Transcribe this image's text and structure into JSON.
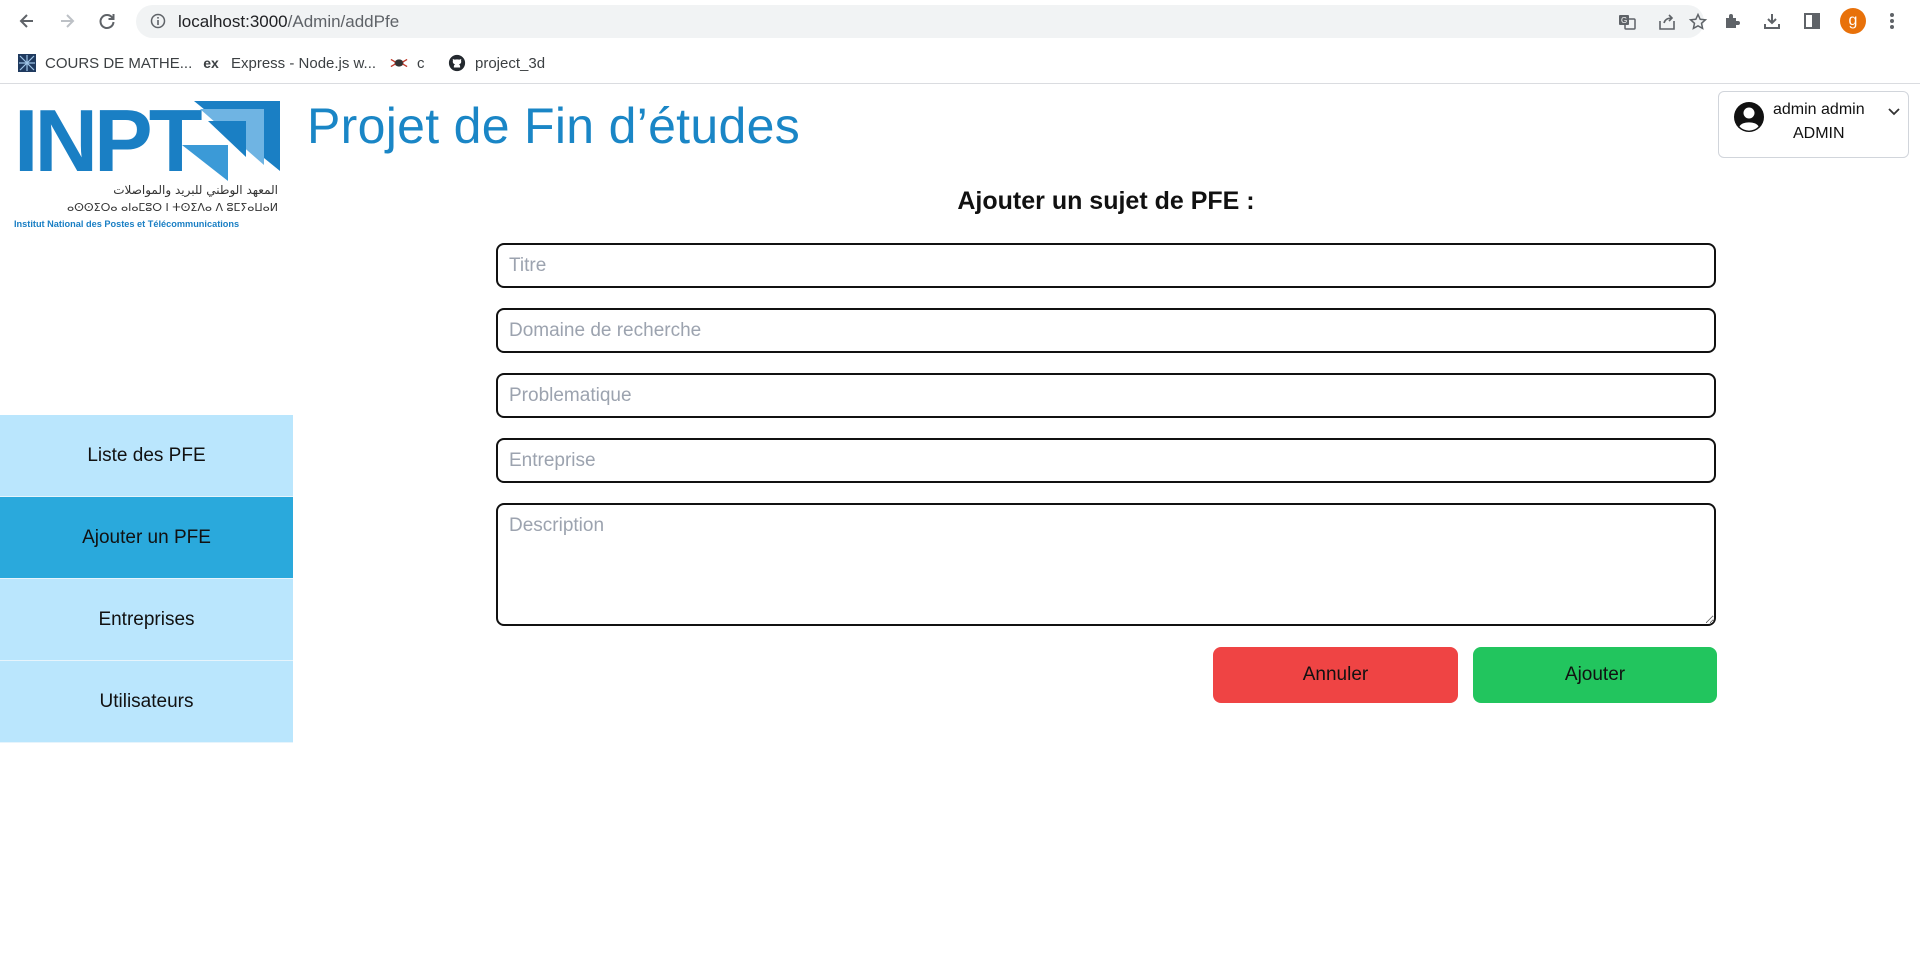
{
  "browser": {
    "url_host": "localhost:3000",
    "url_path": "/Admin/addPfe",
    "profile_initial": "g",
    "bookmarks": [
      {
        "label": "COURS DE MATHE...",
        "icon": "grid-favicon"
      },
      {
        "label": "Express - Node.js w...",
        "icon": "ex"
      },
      {
        "label": "c",
        "icon": "bug-favicon"
      },
      {
        "label": "project_3d",
        "icon": "github-icon"
      }
    ]
  },
  "header": {
    "site_title": "Projet de Fin d’études",
    "logo": {
      "main_text": "INPT",
      "arabic_text": "المعهد الوطني للبريد والمواصلات",
      "tifinagh_text": "ⴰⵙⵙⵉⵔⴰ ⴰⵏⴰⵎⵓⵔ ⵏ ⵜⵙⵉⴷⴰ ⴷ ⵓⵎⵢⴰⵡⴰⵍ",
      "subtitle": "Institut National des Postes et Télécommunications"
    },
    "user": {
      "name": "admin admin",
      "role": "ADMIN"
    }
  },
  "sidebar": {
    "items": [
      {
        "label": "Liste des PFE",
        "active": false
      },
      {
        "label": "Ajouter un PFE",
        "active": true
      },
      {
        "label": "Entreprises",
        "active": false
      },
      {
        "label": "Utilisateurs",
        "active": false
      }
    ]
  },
  "form": {
    "title": "Ajouter un sujet de PFE :",
    "fields": {
      "titre": {
        "placeholder": "Titre",
        "value": ""
      },
      "domaine": {
        "placeholder": "Domaine de recherche",
        "value": ""
      },
      "problematique": {
        "placeholder": "Problematique",
        "value": ""
      },
      "entreprise": {
        "placeholder": "Entreprise",
        "value": ""
      },
      "description": {
        "placeholder": "Description",
        "value": ""
      }
    },
    "cancel_label": "Annuler",
    "submit_label": "Ajouter"
  },
  "colors": {
    "title_blue": "#1a86c6",
    "sidebar_bg": "#bae6fd",
    "sidebar_active": "#2aa9dc",
    "cancel_red": "#ef4444",
    "submit_green": "#22c55e"
  }
}
